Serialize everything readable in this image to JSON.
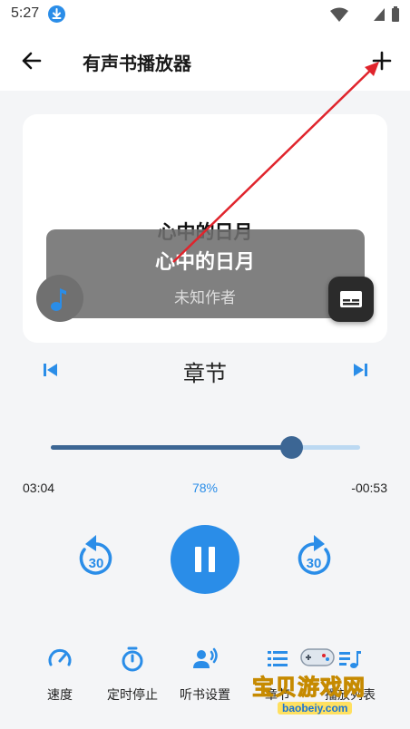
{
  "status_bar": {
    "time": "5:27"
  },
  "app_bar": {
    "title": "有声书播放器"
  },
  "track": {
    "title_top": "心中的日月",
    "title_main": "心中的日月",
    "author": "未知作者"
  },
  "chapter": {
    "label": "章节"
  },
  "progress": {
    "elapsed": "03:04",
    "percent": "78%",
    "remaining": "-00:53",
    "fraction": 0.78
  },
  "controls": {
    "rewind_seconds": "30",
    "forward_seconds": "30"
  },
  "toolbar": {
    "items": [
      {
        "label": "速度",
        "icon": "speedometer-icon"
      },
      {
        "label": "定时停止",
        "icon": "timer-icon"
      },
      {
        "label": "听书设置",
        "icon": "voice-settings-icon"
      },
      {
        "label": "章节",
        "icon": "chapter-list-icon"
      },
      {
        "label": "播放列表",
        "icon": "playlist-icon"
      }
    ]
  },
  "watermark": {
    "text": "宝贝游戏网",
    "url": "baobeiy.com"
  },
  "colors": {
    "accent": "#2a8de8",
    "seek_fill": "#3c6694",
    "seek_track": "#bcd9f2",
    "annotation": "#e0242c"
  }
}
